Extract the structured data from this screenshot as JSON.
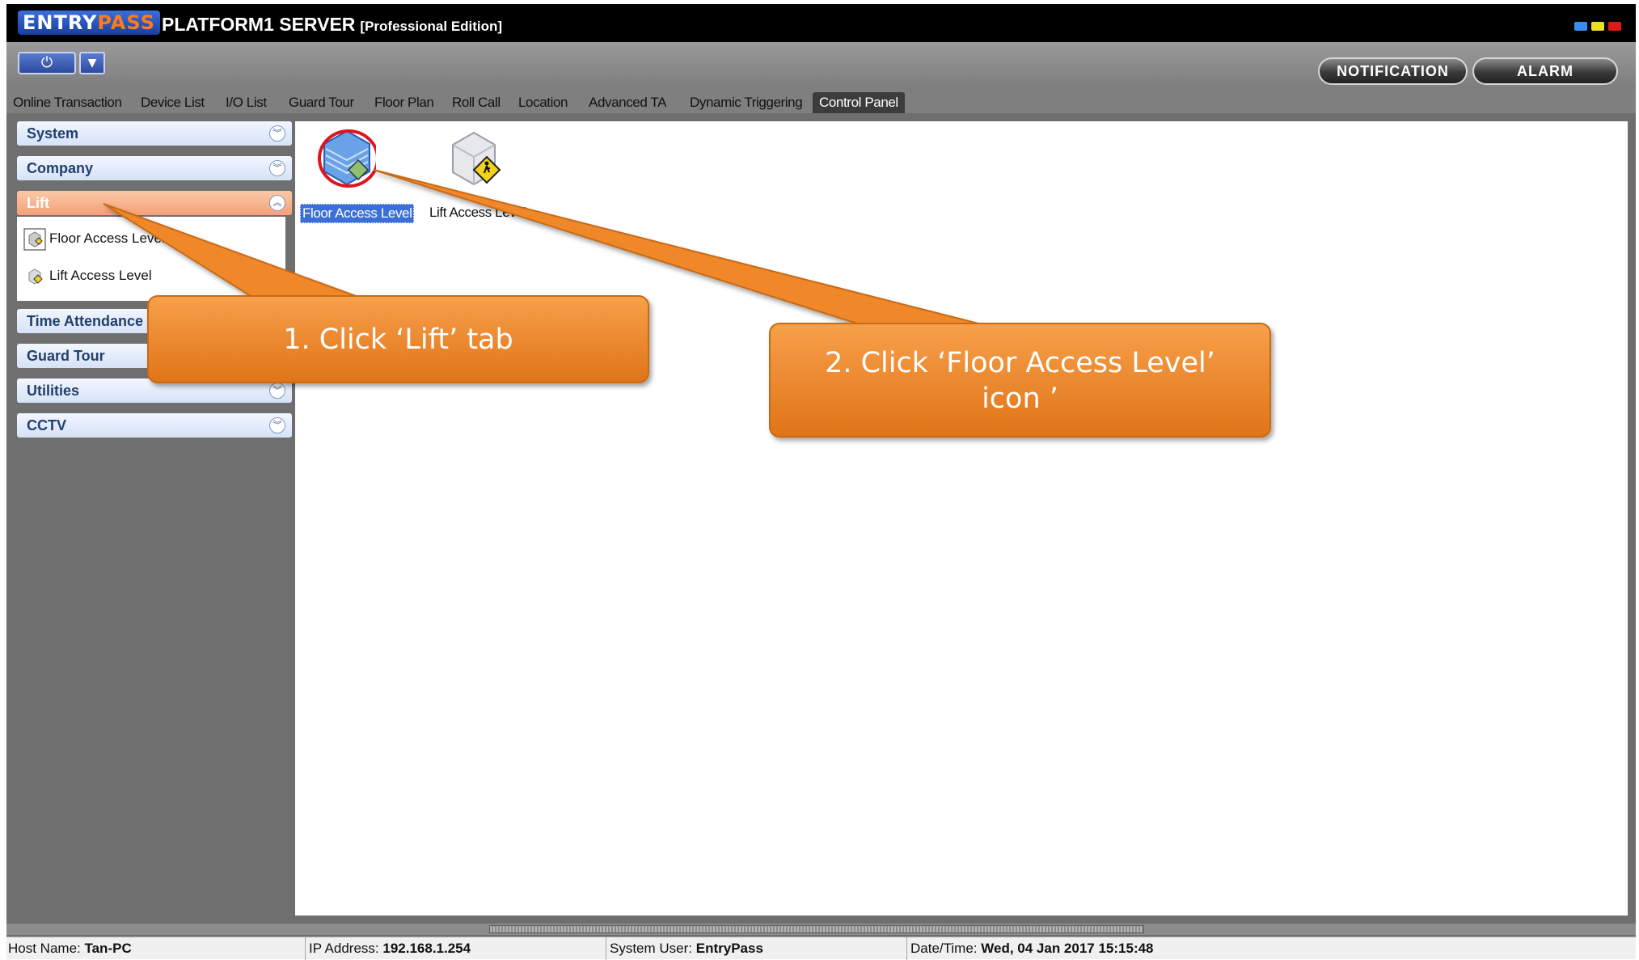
{
  "window": {
    "logo_entry": "ENTRY",
    "logo_pass": "PASS",
    "title": "PLATFORM1 SERVER",
    "edition": "[Professional Edition]"
  },
  "toolbar": {
    "power_icon": "power-icon",
    "dropdown_icon": "chevron-down-icon",
    "notification_label": "NOTIFICATION",
    "alarm_label": "ALARM"
  },
  "tabs": [
    {
      "label": "Online Transaction"
    },
    {
      "label": "Device List"
    },
    {
      "label": "I/O List"
    },
    {
      "label": "Guard Tour"
    },
    {
      "label": "Floor Plan"
    },
    {
      "label": "Roll Call"
    },
    {
      "label": "Location"
    },
    {
      "label": "Advanced TA"
    },
    {
      "label": "Dynamic Triggering"
    },
    {
      "label": "Control Panel"
    }
  ],
  "active_tab": "Control Panel",
  "sidebar": {
    "groups": [
      {
        "label": "System"
      },
      {
        "label": "Company"
      },
      {
        "label": "Lift"
      },
      {
        "label": "Time Attendance"
      },
      {
        "label": "Guard Tour"
      },
      {
        "label": "Utilities"
      },
      {
        "label": "CCTV"
      }
    ],
    "lift_items": [
      {
        "label": "Floor Access Level"
      },
      {
        "label": "Lift Access Level"
      }
    ]
  },
  "main": {
    "icons": [
      {
        "label": "Floor Access Level",
        "icon": "floor-access-level-icon",
        "selected": true
      },
      {
        "label": "Lift Access Level",
        "icon": "lift-access-level-icon",
        "selected": false
      }
    ]
  },
  "callouts": [
    {
      "text": "1. Click ‘Lift’ tab"
    },
    {
      "line1": "2. Click ‘Floor Access Level’",
      "line2": "icon ’"
    }
  ],
  "status": {
    "host_label": "Host Name:",
    "host_value": "Tan-PC",
    "ip_label": "IP Address:",
    "ip_value": "192.168.1.254",
    "user_label": "System User:",
    "user_value": "EntryPass",
    "datetime_label": "Date/Time:",
    "datetime_value": "Wed, 04 Jan 2017 15:15:48"
  },
  "colors": {
    "callout_orange": "#f0882c",
    "selection_blue": "#3b6fd8",
    "highlight_ring": "#e0141e"
  }
}
